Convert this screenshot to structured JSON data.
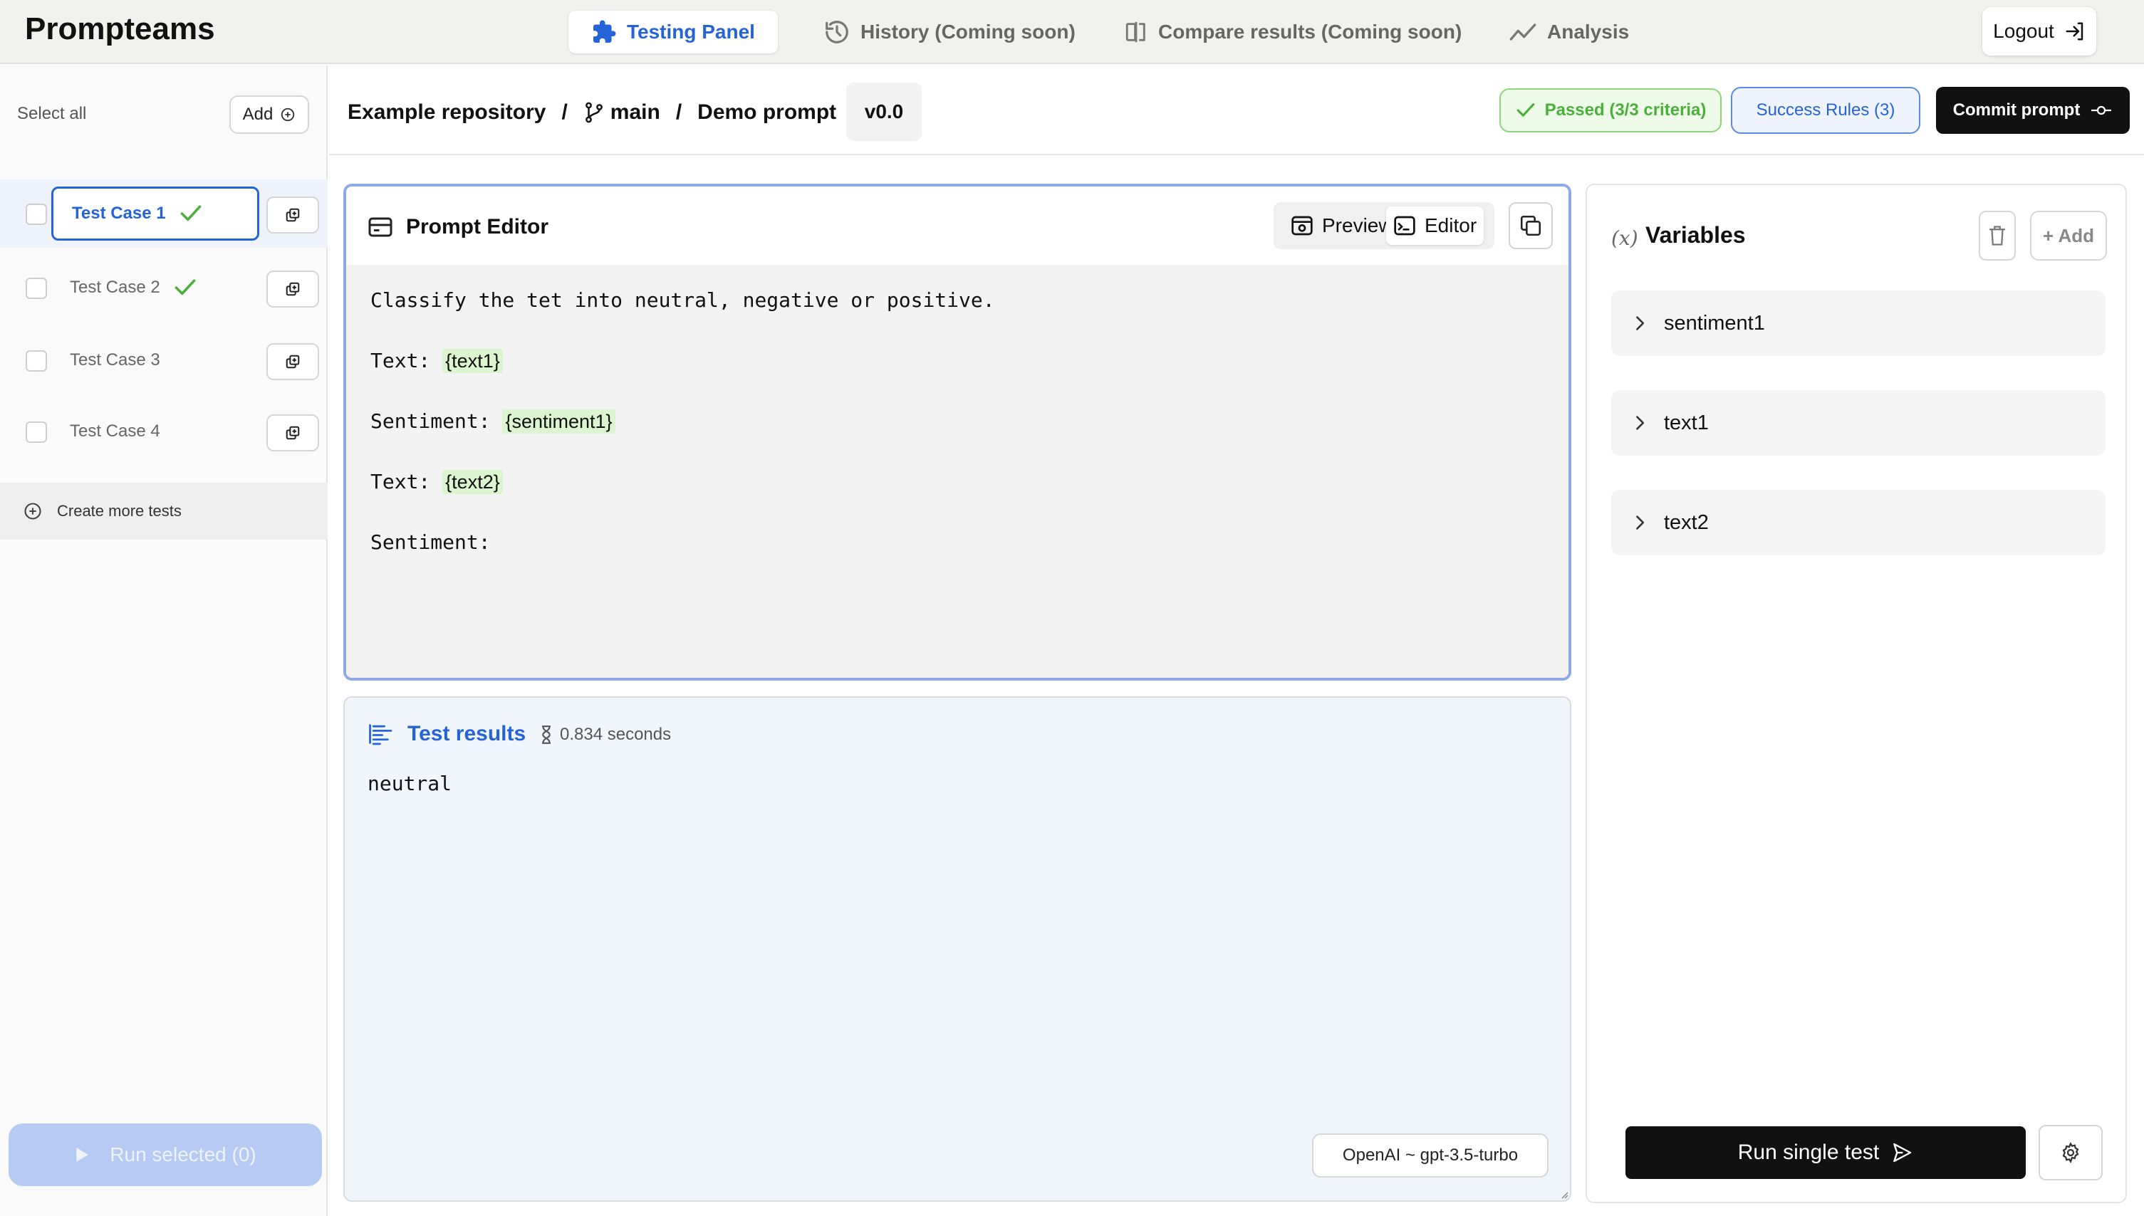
{
  "app": {
    "title": "Prompteams"
  },
  "nav": {
    "tabs": [
      {
        "label": "Testing Panel",
        "icon": "puzzle-icon",
        "active": true
      },
      {
        "label": "History (Coming soon)",
        "icon": "history-icon",
        "active": false
      },
      {
        "label": "Compare results (Coming soon)",
        "icon": "compare-icon",
        "active": false
      },
      {
        "label": "Analysis",
        "icon": "trend-icon",
        "active": false
      }
    ],
    "logout_label": "Logout"
  },
  "sidebar": {
    "select_all_label": "Select all",
    "add_label": "Add",
    "test_cases": [
      {
        "label": "Test Case 1",
        "passed": true,
        "selected": true
      },
      {
        "label": "Test Case 2",
        "passed": true,
        "selected": false
      },
      {
        "label": "Test Case 3",
        "passed": false,
        "selected": false
      },
      {
        "label": "Test Case 4",
        "passed": false,
        "selected": false
      }
    ],
    "create_more_label": "Create more tests",
    "run_selected_label": "Run selected (0)"
  },
  "header": {
    "breadcrumb": {
      "repository": "Example repository",
      "branch": "main",
      "prompt": "Demo prompt",
      "separator": "/"
    },
    "version": "v0.0",
    "passed_label": "Passed (3/3 criteria)",
    "success_rules_label": "Success Rules (3)",
    "commit_label": "Commit prompt"
  },
  "editor": {
    "title": "Prompt Editor",
    "preview_label": "Preview",
    "editor_label": "Editor",
    "lines": [
      {
        "text": "Classify the tet into neutral, negative or positive.",
        "var": ""
      },
      {
        "text": "Text: ",
        "var": "{text1}"
      },
      {
        "text": "Sentiment: ",
        "var": "{sentiment1}"
      },
      {
        "text": "Text: ",
        "var": "{text2}"
      },
      {
        "text": "Sentiment:",
        "var": ""
      }
    ]
  },
  "results": {
    "title": "Test results",
    "duration": "0.834 seconds",
    "output": "neutral",
    "model": "OpenAI ~ gpt-3.5-turbo"
  },
  "variables": {
    "icon_text": "(x)",
    "title": "Variables",
    "add_label": "+ Add",
    "items": [
      "sentiment1",
      "text1",
      "text2"
    ],
    "run_single_label": "Run single test"
  },
  "colors": {
    "accent": "#2563d8",
    "success": "#4bb03a",
    "variable_highlight": "#dbf5cf",
    "dark_button": "#111111"
  }
}
